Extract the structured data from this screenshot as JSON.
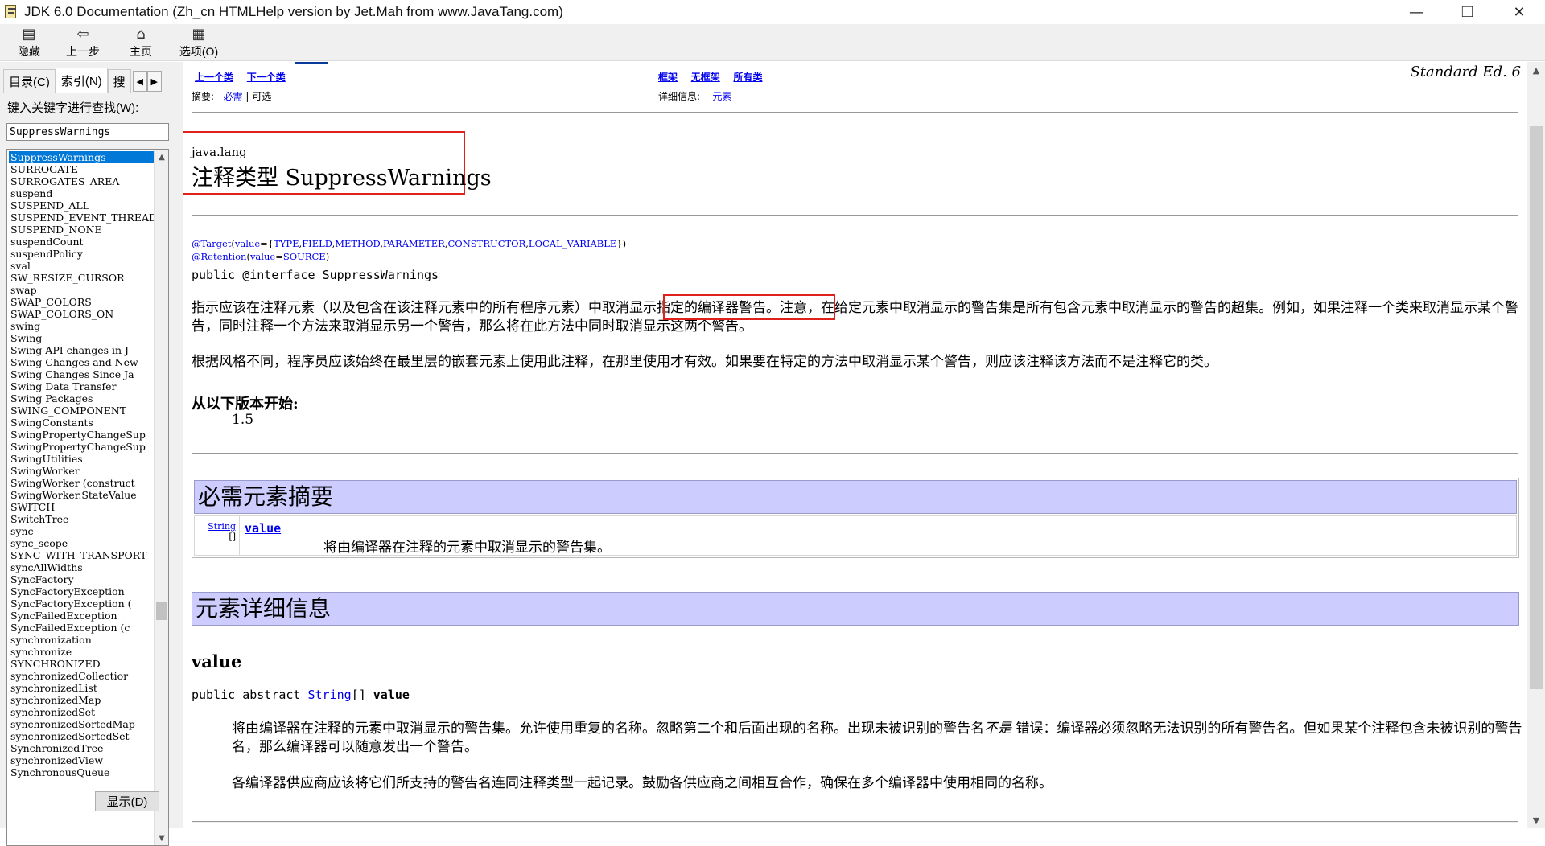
{
  "window": {
    "title": "JDK 6.0 Documentation (Zh_cn HTMLHelp version by Jet.Mah from www.JavaTang.com)",
    "minimize": "—",
    "maximize": "❐",
    "close": "✕"
  },
  "toolbar": {
    "hide": "隐藏",
    "back": "上一步",
    "home": "主页",
    "options": "选项(O)"
  },
  "leftpane": {
    "tabs": [
      "目录(C)",
      "索引(N)",
      "搜"
    ],
    "tab_prev": "◀",
    "tab_next": "▶",
    "search_label": "键入关键字进行查找(W):",
    "search_value": "SuppressWarnings",
    "display_button": "显示(D)",
    "items": [
      "SuppressWarnings",
      "SURROGATE",
      "SURROGATES_AREA",
      "suspend",
      "SUSPEND_ALL",
      "SUSPEND_EVENT_THREAD",
      "SUSPEND_NONE",
      "suspendCount",
      "suspendPolicy",
      "sval",
      "SW_RESIZE_CURSOR",
      "swap",
      "SWAP_COLORS",
      "SWAP_COLORS_ON",
      "swing",
      "Swing",
      "Swing API changes in J",
      "Swing Changes and New",
      "Swing Changes Since Ja",
      "Swing Data Transfer",
      "Swing Packages",
      "SWING_COMPONENT",
      "SwingConstants",
      "SwingPropertyChangeSup",
      "SwingPropertyChangeSup",
      "SwingUtilities",
      "SwingWorker",
      "SwingWorker (construct",
      "SwingWorker.StateValue",
      "SWITCH",
      "SwitchTree",
      "sync",
      "sync_scope",
      "SYNC_WITH_TRANSPORT",
      "syncAllWidths",
      "SyncFactory",
      "SyncFactoryException",
      "SyncFactoryException (",
      "SyncFailedException",
      "SyncFailedException (c",
      "synchronization",
      "synchronize",
      "SYNCHRONIZED",
      "synchronizedCollectior",
      "synchronizedList",
      "synchronizedMap",
      "synchronizedSet",
      "synchronizedSortedMap",
      "synchronizedSortedSet",
      "SynchronizedTree",
      "synchronizedView",
      "SynchronousQueue"
    ]
  },
  "doc": {
    "nav_prev_class": "上一个类",
    "nav_next_class": "下一个类",
    "nav_frames": "框架",
    "nav_noframes": "无框架",
    "nav_allclasses": "所有类",
    "summary_label": "摘要:",
    "summary_required": "必需",
    "summary_sep": " | ",
    "summary_optional": "可选",
    "detail_label": "详细信息:",
    "detail_element": "元素",
    "edition": "Standard Ed. 6",
    "package": "java.lang",
    "type_title": "注释类型 SuppressWarnings",
    "annot_target_prefix": "@Target",
    "annot_target_value_kw": "value",
    "annot_target_items": [
      "TYPE",
      "FIELD",
      "METHOD",
      "PARAMETER",
      "CONSTRUCTOR",
      "LOCAL_VARIABLE"
    ],
    "annot_retention_prefix": "@Retention",
    "annot_retention_value_kw": "value",
    "annot_retention_value": "SOURCE",
    "declaration_prefix": "public @interface ",
    "declaration_name": "SuppressWarnings",
    "desc1_a": "指示应该在注释元素（以及包含在该注释元素中的所有程序元素）",
    "desc1_b": "中取消显示指定的编译器警告。",
    "desc1_c": "注意，在给定元素中取消显示的警告集是所有包含元素中取消显示的警告的超集。例如，如果注释一个类来取消显示某个警告，同时注释一个方法来取消显示另一个警告，那么将在此方法中同时取消显示这两个警告。",
    "desc2": "根据风格不同，程序员应该始终在最里层的嵌套元素上使用此注释，在那里使用才有效。如果要在特定的方法中取消显示某个警告，则应该注释该方法而不是注释它的类。",
    "since_heading": "从以下版本开始:",
    "since_value": "1.5",
    "required_summary_heading": "必需元素摘要",
    "req_type_link": "String",
    "req_type_suffix": "[]",
    "req_name": "value",
    "req_desc": "将由编译器在注释的元素中取消显示的警告集。",
    "element_detail_heading": "元素详细信息",
    "detail_name": "value",
    "detail_sig_prefix": "public abstract ",
    "detail_sig_type": "String",
    "detail_sig_suffix": "[] ",
    "detail_sig_name": "value",
    "detail_desc1_a": "将由编译器在注释的元素中取消显示的警告集。允许使用重复的名称。忽略第二个和后面出现的名称。出现未被识别的警告名",
    "detail_desc1_em": "不是",
    "detail_desc1_b": " 错误：编译器必须忽略无法识别的所有警告名。但如果某个注释包含未被识别的警告名，那么编译器可以随意发出一个警告。",
    "detail_desc2": "各编译器供应商应该将它们所支持的警告名连同注释类型一起记录。鼓励各供应商之间相互合作，确保在多个编译器中使用相同的名称。"
  },
  "colors": {
    "highlight_box": "#e0201a",
    "table_header": "#ccccff",
    "link": "#0000ee",
    "selection": "#0078d7"
  }
}
